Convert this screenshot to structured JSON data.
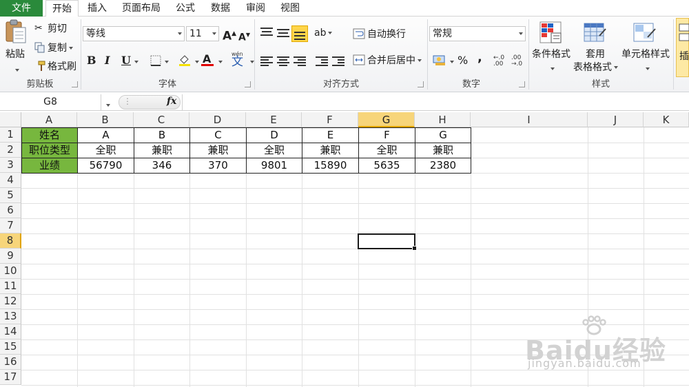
{
  "tabs": [
    {
      "label": "文件"
    },
    {
      "label": "开始"
    },
    {
      "label": "插入"
    },
    {
      "label": "页面布局"
    },
    {
      "label": "公式"
    },
    {
      "label": "数据"
    },
    {
      "label": "审阅"
    },
    {
      "label": "视图"
    }
  ],
  "ribbon": {
    "clipboard": {
      "paste": "粘贴",
      "cut": "剪切",
      "copy": "复制",
      "format_painter": "格式刷",
      "group_label": "剪贴板"
    },
    "font": {
      "font_name": "等线",
      "font_size": "11",
      "bold": "B",
      "italic": "I",
      "underline": "U",
      "grow": "A",
      "shrink": "A",
      "font_color_letter": "A",
      "wen": "wén",
      "wen_char": "文",
      "group_label": "字体"
    },
    "alignment": {
      "wrap_text": "自动换行",
      "merge_center": "合并后居中",
      "group_label": "对齐方式"
    },
    "number": {
      "format": "常规",
      "percent": "%",
      "comma": ",",
      "inc_decimal": ".00→.0",
      "group_label": "数字"
    },
    "styles": {
      "conditional": "条件格式",
      "table_format_1": "套用",
      "table_format_2": "表格格式",
      "cell_styles": "单元格样式",
      "group_label": "样式"
    },
    "cells": {
      "insert": "插"
    }
  },
  "formula_bar": {
    "name_box": "G8",
    "fx": "fx",
    "formula": ""
  },
  "columns": [
    "A",
    "B",
    "C",
    "D",
    "E",
    "F",
    "G",
    "H",
    "I",
    "J",
    "K"
  ],
  "rows": [
    "1",
    "2",
    "3",
    "4",
    "5",
    "6",
    "7",
    "8",
    "9",
    "10",
    "11",
    "12",
    "13",
    "14",
    "15",
    "16",
    "17"
  ],
  "table": {
    "row1": [
      "姓名",
      "A",
      "B",
      "C",
      "D",
      "E",
      "F",
      "G"
    ],
    "row2": [
      "职位类型",
      "全职",
      "兼职",
      "兼职",
      "全职",
      "兼职",
      "全职",
      "兼职"
    ],
    "row3": [
      "业绩",
      "56790",
      "346",
      "370",
      "9801",
      "15890",
      "5635",
      "2380"
    ]
  },
  "colors": {
    "header_green": "#77b73e",
    "file_tab": "#2a8a3b",
    "selection_highlight": "#f7d57a"
  },
  "watermark": {
    "main": "Baidu经验",
    "sub": "jingyan.baidu.com"
  }
}
